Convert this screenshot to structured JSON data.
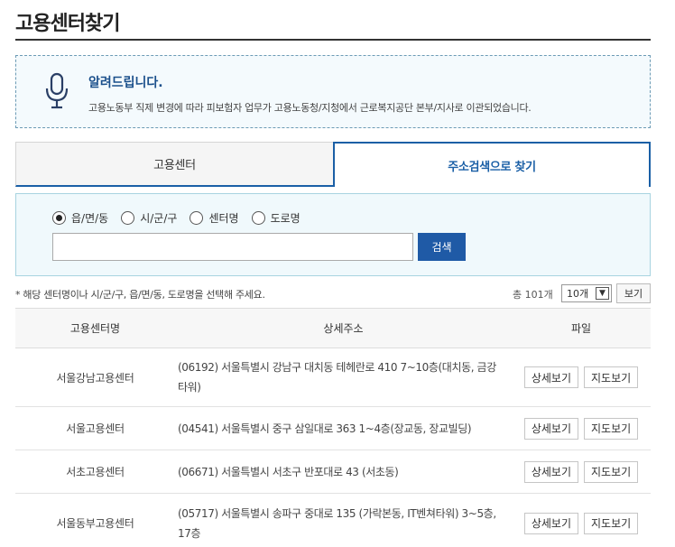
{
  "page": {
    "title": "고용센터찾기"
  },
  "notice": {
    "icon": "microphone-icon",
    "title": "알려드립니다.",
    "text": "고용노동부 직제 변경에 따라 피보험자 업무가 고용노동청/지청에서 근로복지공단 본부/지사로 이관되었습니다."
  },
  "tabs": [
    {
      "label": "고용센터",
      "active": false
    },
    {
      "label": "주소검색으로 찾기",
      "active": true
    }
  ],
  "search": {
    "options": [
      {
        "label": "읍/면/동",
        "checked": true
      },
      {
        "label": "시/군/구",
        "checked": false
      },
      {
        "label": "센터명",
        "checked": false
      },
      {
        "label": "도로명",
        "checked": false
      }
    ],
    "input_value": "",
    "button_label": "검색"
  },
  "results": {
    "hint": "* 해당 센터명이나 시/군/구, 읍/면/동, 도로명을 선택해 주세요.",
    "total": "총 101개",
    "per_page": "10개",
    "view_label": "보기"
  },
  "table": {
    "headers": {
      "name": "고용센터명",
      "address": "상세주소",
      "file": "파일"
    },
    "detail_label": "상세보기",
    "map_label": "지도보기",
    "rows": [
      {
        "name": "서울강남고용센터",
        "address": "(06192) 서울특별시 강남구 대치동 테헤란로 410 7~10층(대치동, 금강타워)"
      },
      {
        "name": "서울고용센터",
        "address": "(04541) 서울특별시 중구 삼일대로 363 1~4층(장교동, 장교빌딩)"
      },
      {
        "name": "서초고용센터",
        "address": "(06671) 서울특별시 서초구 반포대로 43 (서초동)"
      },
      {
        "name": "서울동부고용센터",
        "address": "(05717) 서울특별시 송파구 중대로 135 (가락본동, IT벤쳐타워) 3~5층, 17층"
      }
    ]
  }
}
